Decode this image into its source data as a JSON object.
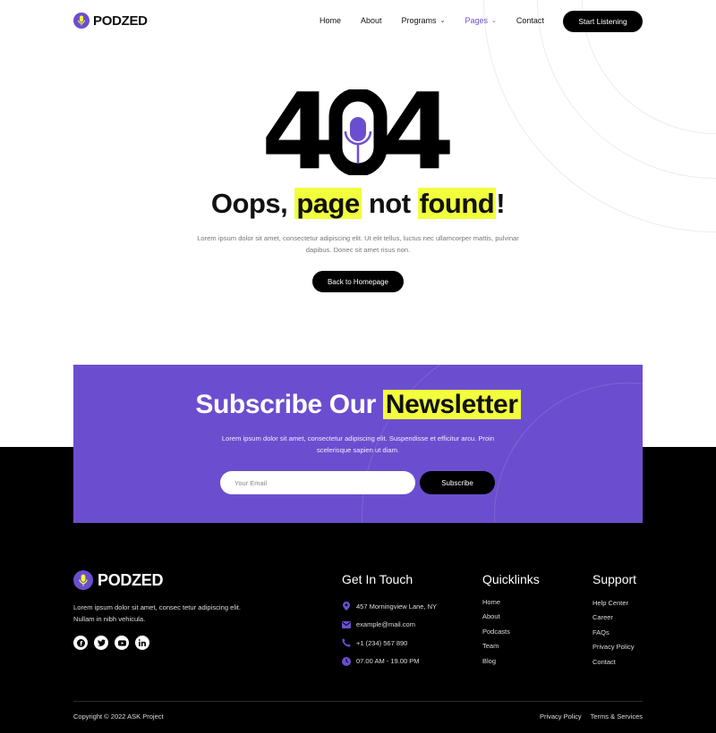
{
  "brand": {
    "name": "PODZED",
    "accent": "#6b4ecf",
    "highlight": "#f2ff3d"
  },
  "nav": {
    "items": [
      {
        "label": "Home",
        "dropdown": false,
        "active": false
      },
      {
        "label": "About",
        "dropdown": false,
        "active": false
      },
      {
        "label": "Programs",
        "dropdown": true,
        "active": false
      },
      {
        "label": "Pages",
        "dropdown": true,
        "active": true
      },
      {
        "label": "Contact",
        "dropdown": false,
        "active": false
      }
    ],
    "cta": "Start Listening"
  },
  "hero": {
    "code_left": "4",
    "code_right": "4",
    "title_pre": "Oops, ",
    "title_hl1": "page",
    "title_mid": " not ",
    "title_hl2": "found",
    "title_end": "!",
    "description": "Lorem ipsum dolor sit amet, consectetur adipiscing elit. Ut elit tellus, luctus nec ullamcorper mattis, pulvinar dapibus. Donec sit amet risus non.",
    "button": "Back to Homepage"
  },
  "newsletter": {
    "title_pre": "Subscribe Our ",
    "title_hl": "Newsletter",
    "description": "Lorem ipsum dolor sit amet, consectetur adipiscing elit. Suspendisse et efficitur arcu. Proin scelerisque sapien ut diam.",
    "placeholder": "Your Email",
    "button": "Subscribe"
  },
  "footer": {
    "brand": "PODZED",
    "description": "Lorem ipsum dolor sit amet, consec tetur adipiscing elit. Nullam in nibh vehicula.",
    "socials": [
      "facebook-icon",
      "twitter-icon",
      "youtube-icon",
      "linkedin-icon"
    ],
    "contact": {
      "title": "Get In Touch",
      "items": [
        {
          "icon": "location-icon",
          "text": "457 Morningview Lane, NY"
        },
        {
          "icon": "mail-icon",
          "text": "example@mail.com"
        },
        {
          "icon": "phone-icon",
          "text": "+1 (234) 567 890"
        },
        {
          "icon": "clock-icon",
          "text": "07.00 AM - 19.00 PM"
        }
      ]
    },
    "quicklinks": {
      "title": "Quicklinks",
      "items": [
        "Home",
        "About",
        "Podcasts",
        "Team",
        "Blog"
      ]
    },
    "support": {
      "title": "Support",
      "items": [
        "Help Center",
        "Career",
        "FAQs",
        "Privacy Policy",
        "Contact"
      ]
    },
    "copyright": "Copyright © 2022 ASK Project",
    "bottom_links": [
      "Privacy Policy",
      "Terms & Services"
    ]
  }
}
